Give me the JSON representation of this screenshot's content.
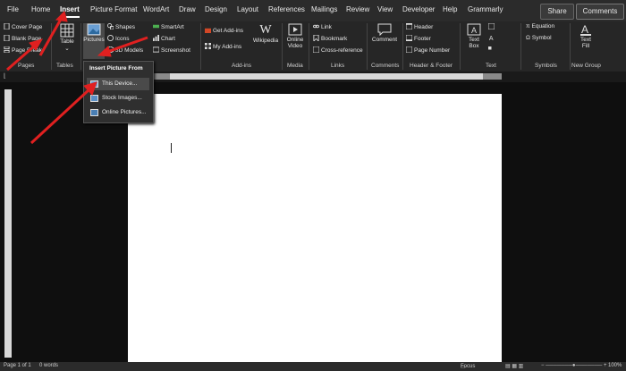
{
  "tabs": [
    "File",
    "Home",
    "Insert",
    "Picture Format",
    "WordArt",
    "Draw",
    "Design",
    "Layout",
    "References",
    "Mailings",
    "Review",
    "View",
    "Developer",
    "Help",
    "Grammarly"
  ],
  "active_tab": "Insert",
  "share_label": "Share",
  "comments_label": "Comments",
  "ribbon": {
    "pages": {
      "items": [
        "Cover Page",
        "Blank Page",
        "Page Break"
      ],
      "label": "Pages"
    },
    "tables": {
      "table": "Table",
      "label": "Tables"
    },
    "illustrations": {
      "pictures": "Pictures",
      "shapes": "Shapes",
      "icons": "Icons",
      "models": "3D Models",
      "smartart": "SmartArt",
      "chart": "Chart",
      "screenshot": "Screenshot"
    },
    "addins": {
      "get": "Get Add-ins",
      "my": "My Add-ins",
      "wikipedia": "Wikipedia",
      "label": "Add-ins"
    },
    "media": {
      "online_video_1": "Online",
      "online_video_2": "Video",
      "label": "Media"
    },
    "links": {
      "link": "Link",
      "bookmark": "Bookmark",
      "cross": "Cross-reference",
      "label": "Links"
    },
    "comments": {
      "comment": "Comment",
      "label": "Comments"
    },
    "header_footer": {
      "header": "Header",
      "footer": "Footer",
      "page_number": "Page Number",
      "label": "Header & Footer"
    },
    "text": {
      "textbox_1": "Text",
      "textbox_2": "Box",
      "label": "Text"
    },
    "symbols": {
      "equation": "Equation",
      "symbol": "Symbol",
      "label": "Symbols"
    },
    "new_group": {
      "textfill_1": "Text",
      "textfill_2": "Fill",
      "label": "New Group"
    }
  },
  "dropdown": {
    "header": "Insert Picture From",
    "items": [
      "This Device...",
      "Stock Images...",
      "Online Pictures..."
    ]
  },
  "status": {
    "page": "Page 1 of 1",
    "words": "0 words",
    "focus": "Focus",
    "zoom": "100%"
  },
  "colors": {
    "accent": "#e02020",
    "background": "#0f0f0f"
  }
}
